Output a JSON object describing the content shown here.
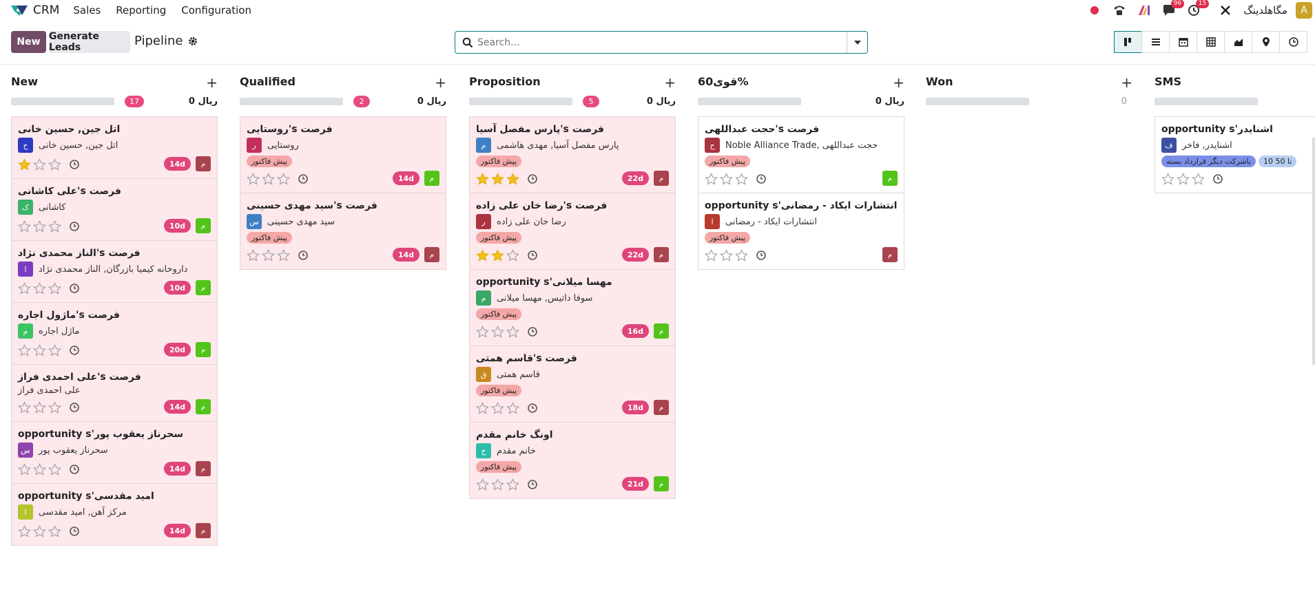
{
  "navbar": {
    "app_name": "CRM",
    "menu": [
      "Sales",
      "Reporting",
      "Configuration"
    ],
    "chat_badge": "96",
    "activity_badge": "15",
    "company": "مگاهلدینگ",
    "user_initial": "A",
    "colors": {
      "record_dot": "#e02d4d",
      "badge": "#e02d4d"
    }
  },
  "control": {
    "new_label": "New",
    "generate_label": "Generate Leads",
    "title": "Pipeline",
    "search_placeholder": "Search..."
  },
  "views": [
    "kanban-icon",
    "list-icon",
    "calendar-icon",
    "pivot-icon",
    "graph-icon",
    "map-icon",
    "activity-icon"
  ],
  "columns": [
    {
      "title": "New",
      "count": "17",
      "sum": "0 ریال",
      "cards": [
        {
          "title": "اتل جین, حسین خانی",
          "partner": "اتل جین, حسین خانی",
          "letter": "ح",
          "color": "#2f3bbf",
          "stars": 1,
          "days": "14d",
          "owner": "م",
          "owner_color": "red",
          "tags": []
        },
        {
          "title": "فرصت s'علی کاشانی",
          "partner": "کاشانی",
          "letter": "ک",
          "color": "#3bb36a",
          "stars": 0,
          "days": "10d",
          "owner": "م",
          "owner_color": "green",
          "tags": []
        },
        {
          "title": "فرصت s'الناز محمدی نژاد",
          "partner": "داروخانه کیمیا بازرگان, الناز محمدی نژاد",
          "letter": "ا",
          "color": "#7a3cc2",
          "stars": 0,
          "days": "10d",
          "owner": "م",
          "owner_color": "green",
          "tags": []
        },
        {
          "title": "فرصت s'ماژول اجاره",
          "partner": "ماژل اجاره",
          "letter": "م",
          "color": "#3bc463",
          "stars": 0,
          "days": "20d",
          "owner": "م",
          "owner_color": "green",
          "tags": []
        },
        {
          "title": "فرصت s'علی احمدی فراز",
          "partner": "علی احمدی فراز",
          "letter": "",
          "color": "",
          "stars": 0,
          "days": "14d",
          "owner": "م",
          "owner_color": "green",
          "tags": []
        },
        {
          "title": "opportunity s'سحرناز یعقوب پور",
          "partner": "سحرناز یعقوب پور",
          "letter": "س",
          "color": "#8e44ad",
          "stars": 0,
          "days": "14d",
          "owner": "م",
          "owner_color": "red",
          "tags": []
        },
        {
          "title": "opportunity s'امید مقدسی",
          "partner": "مرکز آهن, امید مقدسی",
          "letter": "ا",
          "color": "#b5c42d",
          "stars": 0,
          "days": "14d",
          "owner": "م",
          "owner_color": "red",
          "tags": []
        }
      ]
    },
    {
      "title": "Qualified",
      "count": "2",
      "sum": "0 ریال",
      "cards": [
        {
          "title": "فرصت s'روستایی",
          "partner": "روستایی",
          "letter": "ر",
          "color": "#c2305a",
          "stars": 0,
          "days": "14d",
          "owner": "م",
          "owner_color": "green",
          "tags": [
            "پیش فاکتور"
          ]
        },
        {
          "title": "فرصت s'سید مهدی حسینی",
          "partner": "سید مهدی حسینی",
          "letter": "س",
          "color": "#3f7fc4",
          "stars": 0,
          "days": "14d",
          "owner": "م",
          "owner_color": "red",
          "tags": [
            "پیش فاکتور"
          ]
        }
      ]
    },
    {
      "title": "Proposition",
      "count": "5",
      "sum": "0 ریال",
      "cards": [
        {
          "title": "فرصت s'پارس مفصل آسیا",
          "partner": "پارس مفصل آسیا, مهدی هاشمی",
          "letter": "م",
          "color": "#3f7fc4",
          "stars": 3,
          "days": "22d",
          "owner": "م",
          "owner_color": "red",
          "tags": [
            "پیش فاکتور"
          ]
        },
        {
          "title": "فرصت s'رضا خان علی زاده",
          "partner": "رضا خان علی زاده",
          "letter": "ر",
          "color": "#a9343f",
          "stars": 2,
          "days": "22d",
          "owner": "م",
          "owner_color": "red",
          "tags": [
            "پیش فاکتور"
          ]
        },
        {
          "title": "opportunity s'مهسا میلانی",
          "partner": "سوفا داتیس, مهسا میلانی",
          "letter": "م",
          "color": "#3aa865",
          "stars": 0,
          "days": "16d",
          "owner": "م",
          "owner_color": "green",
          "tags": [
            "پیش فاکتور"
          ]
        },
        {
          "title": "فرصت s'قاسم همتی",
          "partner": "قاسم همتی",
          "letter": "ق",
          "color": "#c98a1d",
          "stars": 0,
          "days": "18d",
          "owner": "م",
          "owner_color": "red",
          "tags": [
            "پیش فاکتور"
          ]
        },
        {
          "title": "اونگ خانم مقدم",
          "partner": "خانم مقدم",
          "letter": "خ",
          "color": "#2dbda8",
          "stars": 0,
          "days": "21d",
          "owner": "م",
          "owner_color": "green",
          "tags": [
            "پیش فاکتور"
          ]
        }
      ]
    },
    {
      "title": "قوی60%",
      "count": "",
      "sum": "0 ریال",
      "cards": [
        {
          "title": "فرصت s'حجت عبداللهی",
          "partner": "Noble Alliance Trade, حجت عبداللهی",
          "letter": "ح",
          "color": "#a9343f",
          "stars": 0,
          "days": "",
          "owner": "م",
          "owner_color": "green",
          "tags": [
            "پیش فاکتور"
          ]
        },
        {
          "title": "opportunity s'انتشارات ایکاد - رمضانی",
          "partner": "انتشارات ایکاد - رمضانی",
          "letter": "ا",
          "color": "#b83a2c",
          "stars": 0,
          "days": "",
          "owner": "م",
          "owner_color": "red",
          "tags": [
            "پیش فاکتور"
          ]
        }
      ]
    },
    {
      "title": "Won",
      "count": "",
      "sum": "0",
      "cards": []
    },
    {
      "title": "SMS",
      "count": "",
      "sum": "",
      "cards": [
        {
          "title": "opportunity s'اشنایدر",
          "partner": "اشنایدر, فاخر",
          "letter": "ف",
          "color": "#3b4fa3",
          "stars": 0,
          "days": "",
          "owner": "",
          "owner_color": "",
          "tags": [
            "باشرکت دیگر قرارداد بسته",
            "تا 50 10"
          ]
        }
      ]
    }
  ]
}
